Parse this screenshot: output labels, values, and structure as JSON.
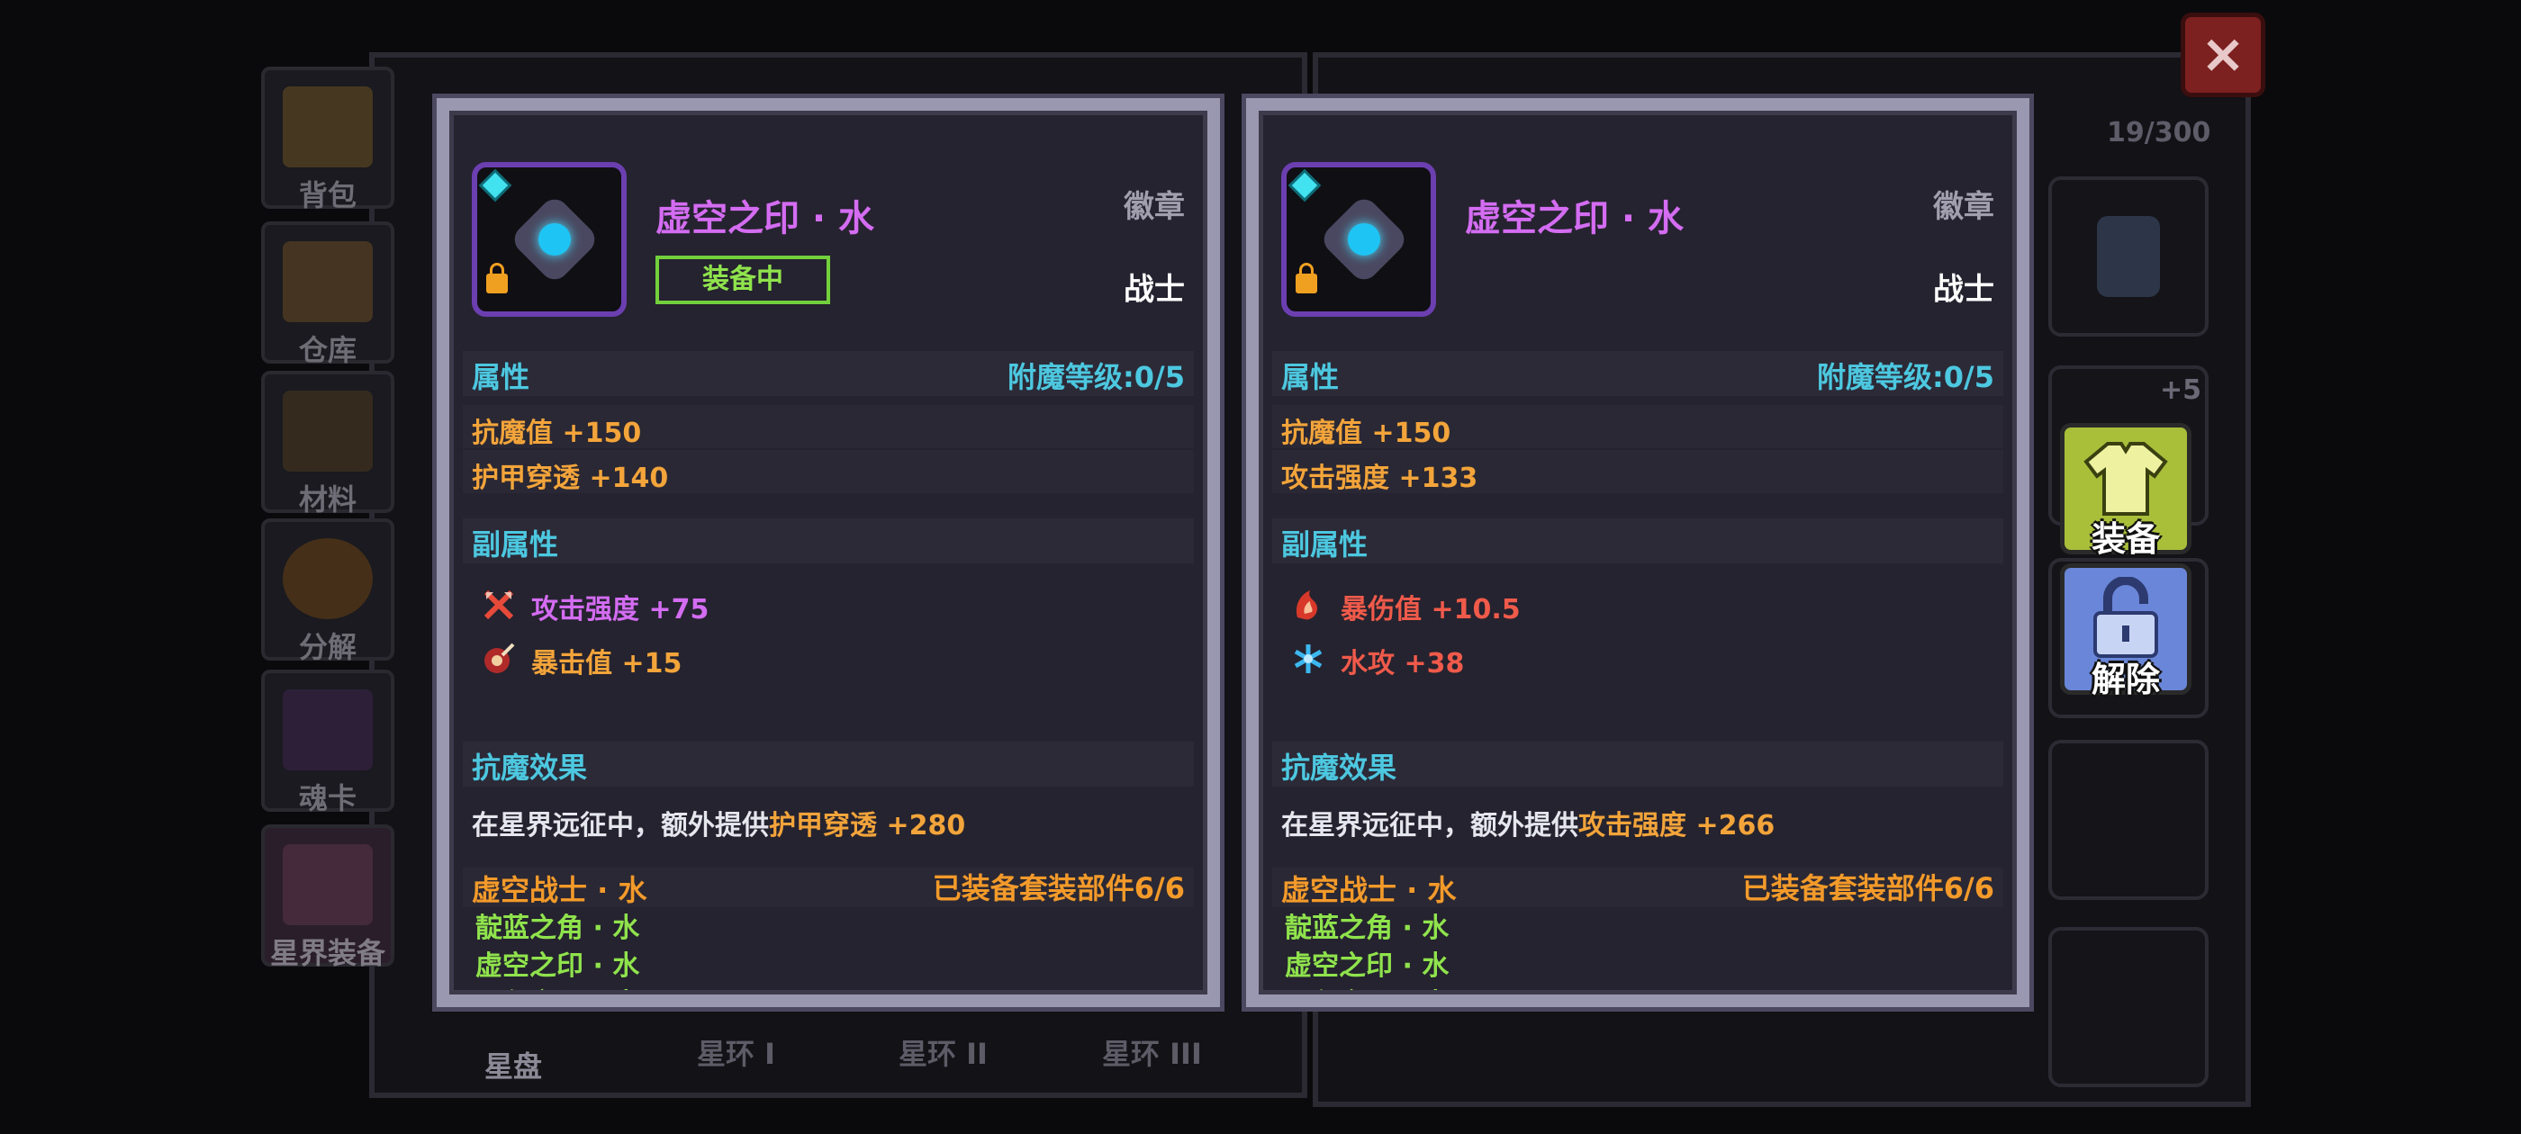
{
  "background": {
    "side_tabs": [
      {
        "label": "背包"
      },
      {
        "label": "仓库"
      },
      {
        "label": "材料"
      },
      {
        "label": "分解"
      },
      {
        "label": "魂卡"
      },
      {
        "label": "星界装备"
      }
    ],
    "bottom_tabs": [
      "星盘",
      "星环 I",
      "星环 II",
      "星环 III"
    ],
    "inventory_count": "19/300",
    "slot_enhance": "+5"
  },
  "close_button": {
    "label": "×"
  },
  "actions": {
    "equip_label": "装备",
    "unlock_label": "解除"
  },
  "panels": [
    {
      "name": "虚空之印 · 水",
      "type": "徽章",
      "class": "战士",
      "badge": "装备中",
      "attr_title": "属性",
      "enchant": "附魔等级:0/5",
      "main_stats": [
        "抗魔值 +150",
        "护甲穿透 +140"
      ],
      "sub_title": "副属性",
      "sub_stats": [
        {
          "icon": "sword-icon",
          "text": "攻击强度 +75",
          "color": "#d46cf2"
        },
        {
          "icon": "crit-icon",
          "text": "暴击值 +15",
          "color": "#f3a43a"
        }
      ],
      "effect_title": "抗魔效果",
      "effect_prefix": "在星界远征中，额外提供",
      "effect_highlight": "护甲穿透 +280",
      "set_name": "虚空战士 · 水",
      "set_count": "已装备套装部件6/6",
      "set_items": [
        "靛蓝之角 · 水",
        "虚空之印 · 水",
        "远程之心 · 水"
      ]
    },
    {
      "name": "虚空之印 · 水",
      "type": "徽章",
      "class": "战士",
      "attr_title": "属性",
      "enchant": "附魔等级:0/5",
      "main_stats": [
        "抗魔值 +150",
        "攻击强度 +133"
      ],
      "sub_title": "副属性",
      "sub_stats": [
        {
          "icon": "crit-damage-icon",
          "text": "暴伤值 +10.5",
          "color": "#f05a4a"
        },
        {
          "icon": "water-attack-icon",
          "text": "水攻 +38",
          "color": "#f05a4a"
        }
      ],
      "effect_title": "抗魔效果",
      "effect_prefix": "在星界远征中，额外提供",
      "effect_highlight": "攻击强度 +266",
      "set_name": "虚空战士 · 水",
      "set_count": "已装备套装部件6/6",
      "set_items": [
        "靛蓝之角 · 水",
        "虚空之印 · 水",
        "远程之心 · 水"
      ]
    }
  ]
}
